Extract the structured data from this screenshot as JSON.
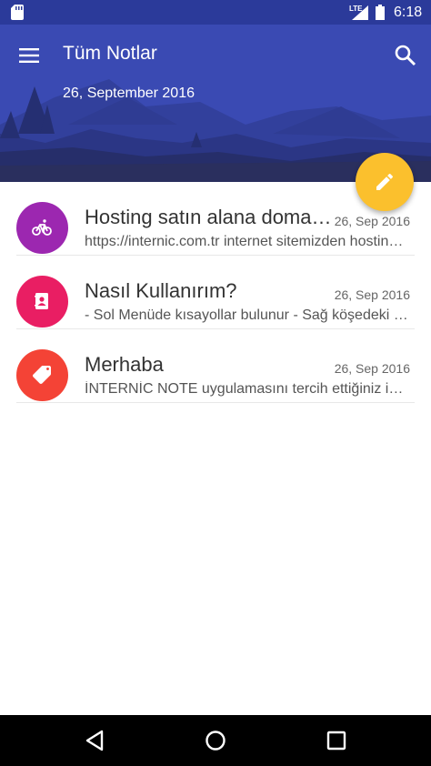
{
  "status_bar": {
    "time": "6:18",
    "network": "LTE",
    "icons": [
      "sd-card-icon",
      "signal-icon",
      "battery-icon"
    ]
  },
  "header": {
    "title": "Tüm Notlar",
    "date": "26, September 2016",
    "background_color": "#3a4ab3"
  },
  "fab": {
    "icon": "pencil-icon",
    "color": "#fbc02d"
  },
  "notes": [
    {
      "title": "Hosting satın alana domain bedava!",
      "date": "26, Sep 2016",
      "body": "https://internic.com.tr internet sitemizden hosting satın alan müşterilerimize domain hediye",
      "icon": "bicycle-icon",
      "color": "#9c27b0"
    },
    {
      "title": "Nasıl Kullanırım?",
      "date": "26, Sep 2016",
      "body": "- Sol Menüde kısayollar bulunur  - Sağ köşedeki butonla not ekleyebilirsiniz",
      "icon": "contact-book-icon",
      "color": "#e91e63"
    },
    {
      "title": "Merhaba",
      "date": "26, Sep 2016",
      "body": "İNTERNİC NOTE uygulamasını tercih ettiğiniz için teşekkür ederiz",
      "icon": "tag-icon",
      "color": "#f44336"
    }
  ],
  "nav_bar": {
    "buttons": [
      "back-icon",
      "home-icon",
      "recents-icon"
    ]
  }
}
